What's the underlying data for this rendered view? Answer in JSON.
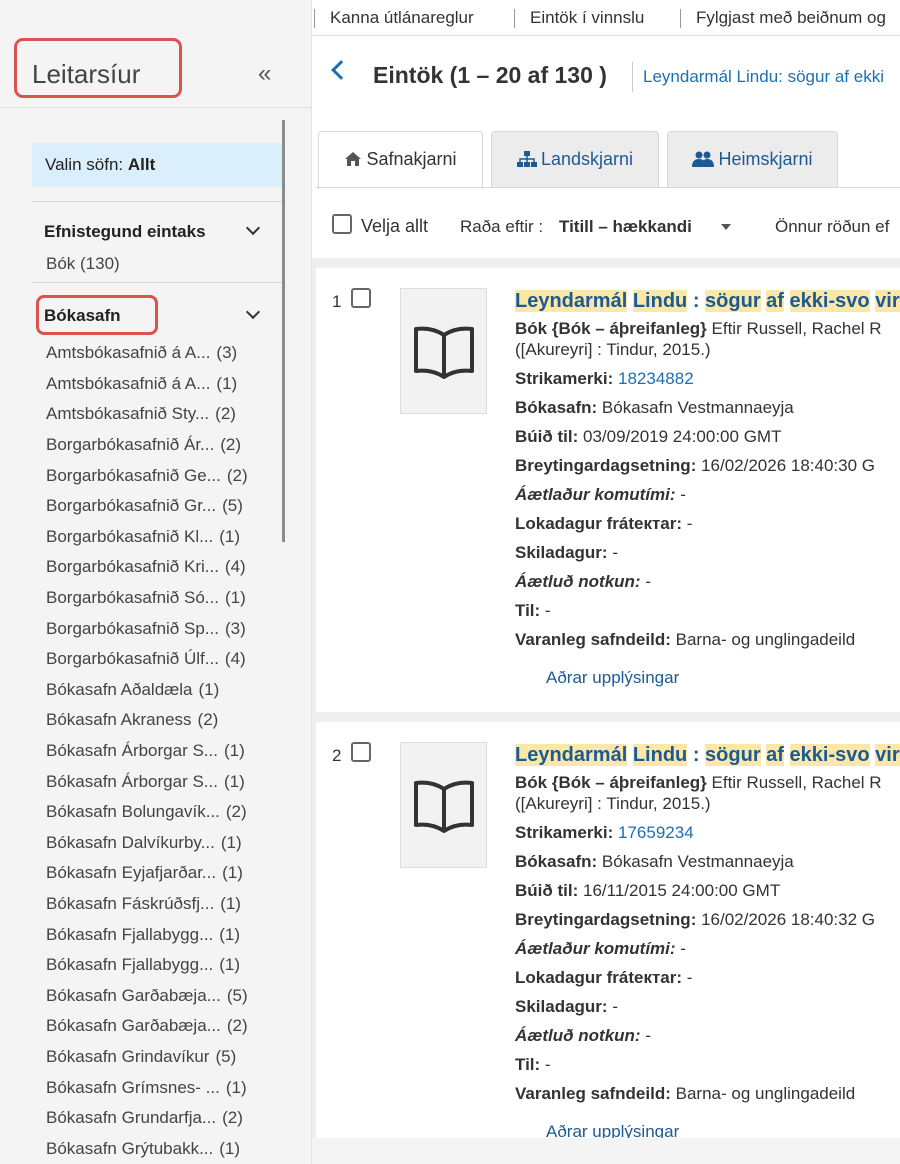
{
  "sidebar": {
    "title": "Leitarsíur",
    "collapse_icon": "«",
    "selected_label": "Valin söfn:",
    "selected_value": "Allt",
    "facet1": {
      "title": "Efnistegund eintaks",
      "value": "Bók (130)"
    },
    "facet2": {
      "title": "Bókasafn"
    },
    "libraries": [
      {
        "name": "Amtsbókasafnið á A...",
        "count": "(3)"
      },
      {
        "name": "Amtsbókasafnið á A...",
        "count": "(1)"
      },
      {
        "name": "Amtsbókasafnið Sty...",
        "count": "(2)"
      },
      {
        "name": "Borgarbókasafnið Ár...",
        "count": "(2)"
      },
      {
        "name": "Borgarbókasafnið Ge...",
        "count": "(2)"
      },
      {
        "name": "Borgarbókasafnið Gr...",
        "count": "(5)"
      },
      {
        "name": "Borgarbókasafnið Kl...",
        "count": "(1)"
      },
      {
        "name": "Borgarbókasafnið Kri...",
        "count": "(4)"
      },
      {
        "name": "Borgarbókasafnið Só...",
        "count": "(1)"
      },
      {
        "name": "Borgarbókasafnið Sp...",
        "count": "(3)"
      },
      {
        "name": "Borgarbókasafnið Úlf...",
        "count": "(4)"
      },
      {
        "name": "Bókasafn Aðaldæla",
        "count": "(1)"
      },
      {
        "name": "Bókasafn Akraness",
        "count": "(2)"
      },
      {
        "name": "Bókasafn Árborgar S...",
        "count": "(1)"
      },
      {
        "name": "Bókasafn Árborgar S...",
        "count": "(1)"
      },
      {
        "name": "Bókasafn Bolungavík...",
        "count": "(2)"
      },
      {
        "name": "Bókasafn Dalvíkurby...",
        "count": "(1)"
      },
      {
        "name": "Bókasafn Eyjafjarðar...",
        "count": "(1)"
      },
      {
        "name": "Bókasafn Fáskrúðsfj...",
        "count": "(1)"
      },
      {
        "name": "Bókasafn Fjallabygg...",
        "count": "(1)"
      },
      {
        "name": "Bókasafn Fjallabygg...",
        "count": "(1)"
      },
      {
        "name": "Bókasafn Garðabæja...",
        "count": "(5)"
      },
      {
        "name": "Bókasafn Garðabæja...",
        "count": "(2)"
      },
      {
        "name": "Bókasafn Grindavíkur",
        "count": "(5)"
      },
      {
        "name": "Bókasafn Grímsnes- ...",
        "count": "(1)"
      },
      {
        "name": "Bókasafn Grundarfja...",
        "count": "(2)"
      },
      {
        "name": "Bókasafn Grýtubakk...",
        "count": "(1)"
      }
    ]
  },
  "topnav": {
    "links": [
      "Kanna útlánareglur",
      "Eintök í vinnslu",
      "Fylgjast með beiðnum og"
    ]
  },
  "header": {
    "title": "Eintök (1 – 20 af 130 )",
    "record_link": "Leyndarmál Lindu: sögur af ekki"
  },
  "tabs": [
    {
      "label": "Safnakjarni",
      "icon": "home-icon"
    },
    {
      "label": "Landskjarni",
      "icon": "sitemap-icon"
    },
    {
      "label": "Heimskjarni",
      "icon": "users-icon"
    }
  ],
  "toolbar": {
    "select_all": "Velja allt",
    "sort_label": "Raða eftir :",
    "sort_value": "Titill – hækkandi",
    "other_sort": "Önnur röðun ef"
  },
  "labels": {
    "barcode": "Strikamerki:",
    "library": "Bókasafn:",
    "created": "Búið til:",
    "modified": "Breytingardagsetning:",
    "est_arrival": "Áætlaður komutími:",
    "hold_end": "Lokadagur fráteктar:",
    "due": "Skiladagur:",
    "est_use": "Áætluð notkun:",
    "to": "Til:",
    "perm_location": "Varanleg safndeild:",
    "more": "Aðrar upplýsingar"
  },
  "items": [
    {
      "number": "1",
      "title_parts": [
        "Leyndarmál",
        " ",
        "Lindu",
        " : ",
        "sögur",
        " ",
        "af",
        " ",
        "ekki-svo",
        " ",
        "vir"
      ],
      "type": "Bók {Bók – áþreifanleg}",
      "author": " Eftir Russell, Rachel R",
      "pub": "([Akureyri] : Tindur, 2015.)",
      "barcode": "18234882",
      "library": " Bókasafn Vestmannaeyja",
      "created": " 03/09/2019 24:00:00 GMT",
      "modified": " 16/02/2026 18:40:30 G",
      "est_arrival": " -",
      "hold_end": " -",
      "due": " -",
      "est_use": " -",
      "to": " -",
      "perm_location": " Barna- og unglingadeild"
    },
    {
      "number": "2",
      "title_parts": [
        "Leyndarmál",
        " ",
        "Lindu",
        " : ",
        "sögur",
        " ",
        "af",
        " ",
        "ekki-svo",
        " ",
        "vir"
      ],
      "type": "Bók {Bók – áþreifanleg}",
      "author": " Eftir Russell, Rachel R",
      "pub": "([Akureyri] : Tindur, 2015.)",
      "barcode": "17659234",
      "library": " Bókasafn Vestmannaeyja",
      "created": " 16/11/2015 24:00:00 GMT",
      "modified": " 16/02/2026 18:40:32 G",
      "est_arrival": " -",
      "hold_end": " -",
      "due": " -",
      "est_use": " -",
      "to": " -",
      "perm_location": " Barna- og unglingadeild"
    }
  ]
}
